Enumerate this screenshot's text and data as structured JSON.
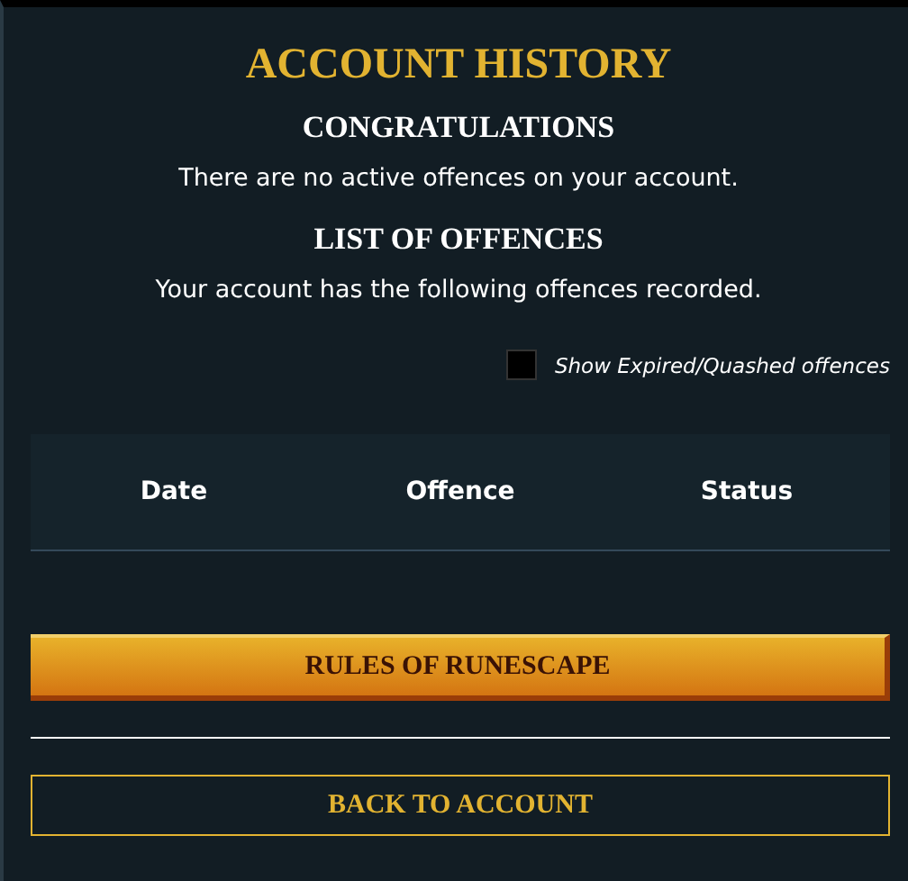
{
  "title": "ACCOUNT HISTORY",
  "sections": [
    {
      "heading": "CONGRATULATIONS",
      "text": "There are no active offences on your account."
    },
    {
      "heading": "LIST OF OFFENCES",
      "text": "Your account has the following offences recorded."
    }
  ],
  "show_expired": {
    "label": "Show Expired/Quashed offences",
    "checked": false
  },
  "table": {
    "columns": [
      "Date",
      "Offence",
      "Status"
    ]
  },
  "buttons": [
    {
      "label": "RULES OF RUNESCAPE",
      "kind": "primary"
    },
    {
      "label": "BACK TO ACCOUNT",
      "kind": "outline"
    }
  ]
}
